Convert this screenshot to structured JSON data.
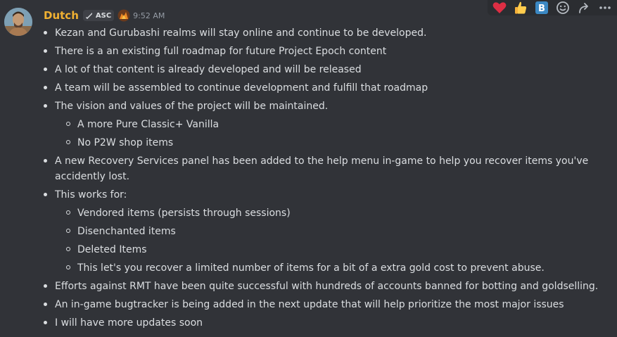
{
  "author": {
    "name": "Dutch",
    "tag": "ASC",
    "timestamp": "9:52 AM"
  },
  "toolbar": {
    "reactions": [
      "heart-icon",
      "thumbs-up-icon",
      "b-emoji-icon"
    ],
    "actions": [
      "add-reaction-icon",
      "reply-icon",
      "more-icon"
    ]
  },
  "items": [
    {
      "text": "Kezan and Gurubashi realms will stay online and continue to be developed."
    },
    {
      "text": "There is a an existing full roadmap for future Project Epoch content"
    },
    {
      "text": "A lot of that content is already developed and will be released"
    },
    {
      "text": "A team will be assembled to continue development and fulfill that roadmap"
    },
    {
      "text": "The vision and values of the project will be maintained.",
      "sub": [
        "A more Pure Classic+ Vanilla",
        "No P2W shop items"
      ]
    },
    {
      "text": "A new Recovery Services panel has been added to the help menu in-game to help you recover items you've accidently lost."
    },
    {
      "text": "This works for:",
      "sub": [
        "Vendored items (persists through sessions)",
        "Disenchanted items",
        "Deleted Items",
        "This let's you recover a limited number of items for a bit of a extra gold cost to prevent abuse."
      ]
    },
    {
      "text": "Efforts against RMT have been quite successful with hundreds of accounts banned for botting and goldselling."
    },
    {
      "text": "An in-game bugtracker is being added in the next update that will help prioritize the most major issues"
    },
    {
      "text": "I will have more updates soon"
    }
  ]
}
